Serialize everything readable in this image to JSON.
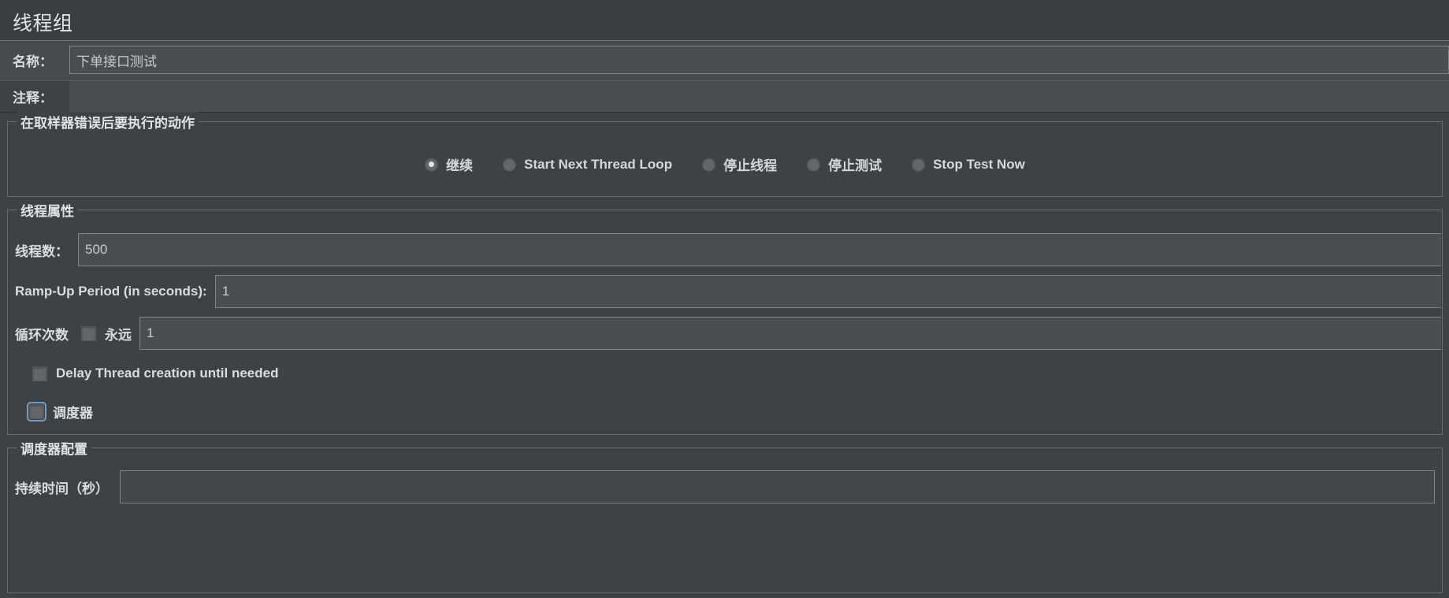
{
  "window": {
    "title": "线程组"
  },
  "name_row": {
    "label": "名称：",
    "value": "下单接口测试"
  },
  "comment_row": {
    "label": "注释：",
    "value": ""
  },
  "sampler_error_group": {
    "title": "在取样器错误后要执行的动作",
    "options": [
      {
        "label": "继续",
        "selected": true
      },
      {
        "label": "Start Next Thread Loop",
        "selected": false
      },
      {
        "label": "停止线程",
        "selected": false
      },
      {
        "label": "停止测试",
        "selected": false
      },
      {
        "label": "Stop Test Now",
        "selected": false
      }
    ]
  },
  "thread_properties": {
    "title": "线程属性",
    "threads": {
      "label": "线程数：",
      "value": "500"
    },
    "ramp_up": {
      "label": "Ramp-Up Period (in seconds):",
      "value": "1"
    },
    "loop_count": {
      "label": "循环次数",
      "forever_label": "永远",
      "forever_checked": false,
      "value": "1"
    },
    "delay_thread_creation": {
      "label": "Delay Thread creation until needed",
      "checked": false
    },
    "scheduler": {
      "label": "调度器",
      "checked": false,
      "focused": true
    }
  },
  "scheduler_config": {
    "title": "调度器配置",
    "duration": {
      "label": "持续时间（秒）",
      "value": ""
    }
  },
  "colors": {
    "background": "#3f4244",
    "field_background": "#4a4e50",
    "border": "#6a6f72",
    "text": "#d9dcdd",
    "focus_ring": "#6f9fc4"
  }
}
